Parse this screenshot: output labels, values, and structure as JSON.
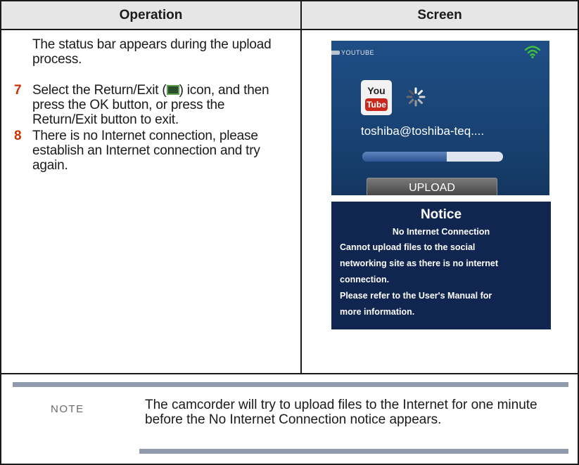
{
  "table": {
    "header_operation": "Operation",
    "header_screen": "Screen"
  },
  "operation": {
    "intro": "The status bar appears during the upload process.",
    "step7_number": "7",
    "step7_text_before": "Select the Return/Exit (",
    "step7_text_after": ") icon, and then press the OK button, or press the Return/Exit button to exit.",
    "step8_number": "8",
    "step8_text": "There is no Internet connection, please establish an Internet connection and try again."
  },
  "upload_screen": {
    "app_label": "YOUTUBE",
    "logo_you": "You",
    "logo_tube": "Tube",
    "account": "toshiba@toshiba-teq....",
    "progress": 0.6,
    "button_label": "UPLOAD",
    "colors": {
      "background": "#1f4e86",
      "progress": "#2d5694",
      "wifi": "#3ec23a"
    }
  },
  "notice_screen": {
    "title": "Notice",
    "subtitle": "No Internet Connection",
    "lines": [
      "Cannot upload files to the social",
      "networking site as there is no internet",
      "connection.",
      "Please refer to the User's Manual for",
      "more information."
    ],
    "colors": {
      "background": "#10254f"
    }
  },
  "note": {
    "label": "NOTE",
    "text": "The camcorder will try to upload files to the Internet for one minute before the No Internet Connection notice appears."
  }
}
